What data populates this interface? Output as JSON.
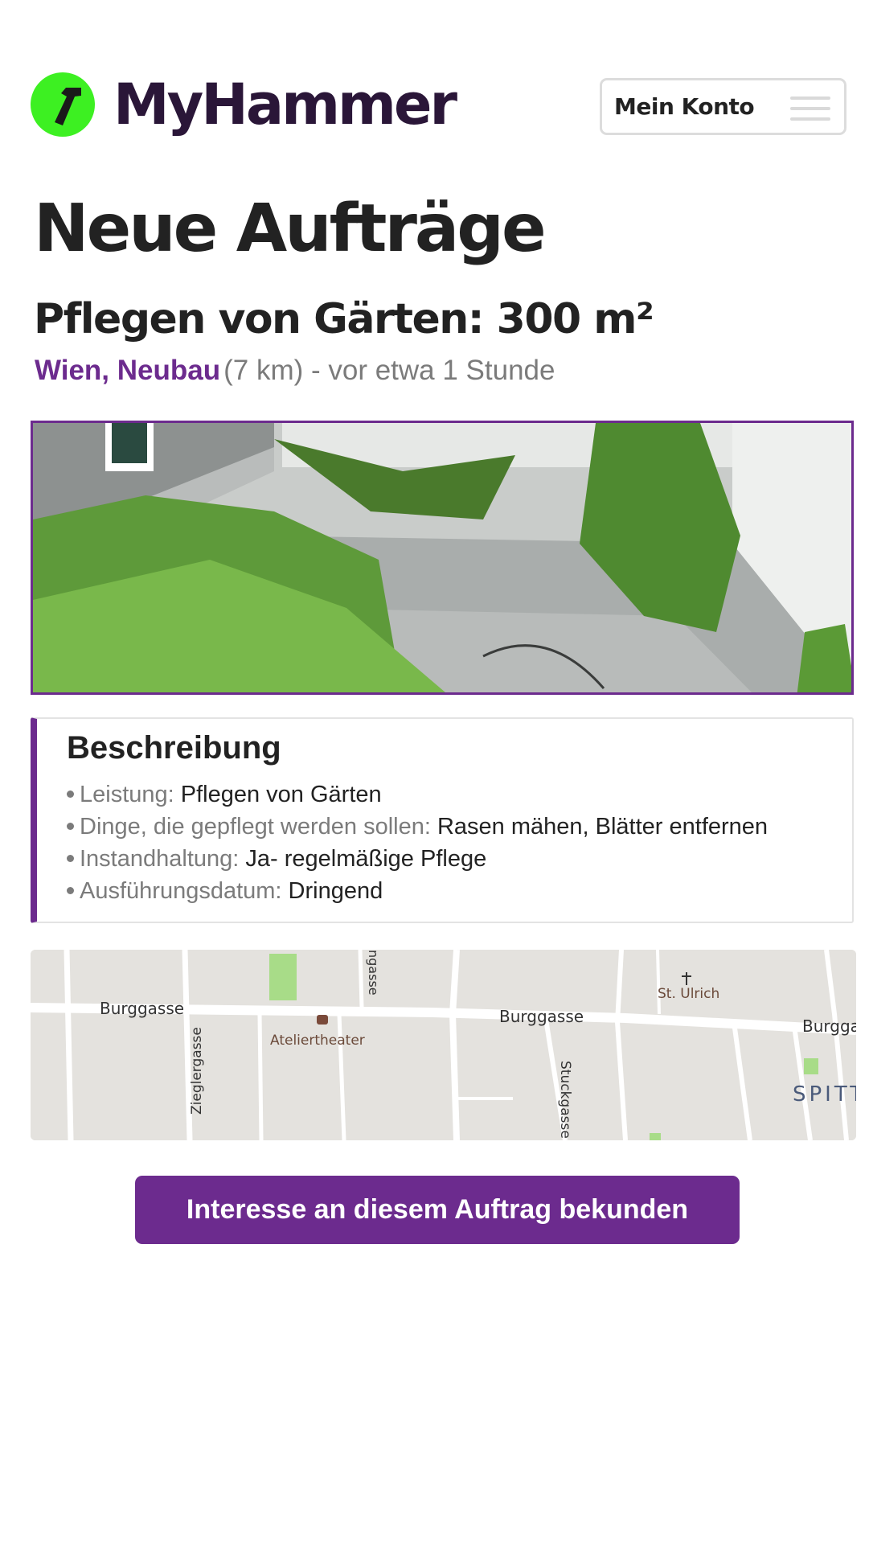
{
  "brand": {
    "name": "MyHammer",
    "icon": "hammer-icon",
    "accent": "#3df022",
    "text_color": "#2a1638"
  },
  "header": {
    "account_label": "Mein Konto",
    "menu_icon": "hamburger-menu-icon"
  },
  "page": {
    "title": "Neue Aufträge"
  },
  "job": {
    "title": "Pflegen von Gärten: 300 m²",
    "location": "Wien, Neubau",
    "distance_time": "(7 km) - vor etwa 1 Stunde",
    "accent": "#6c2b8e"
  },
  "description": {
    "title": "Beschreibung",
    "items": [
      {
        "label": "Leistung:",
        "value": "Pflegen von Gärten"
      },
      {
        "label": "Dinge, die gepflegt werden sollen:",
        "value": "Rasen mähen, Blätter entfernen"
      },
      {
        "label": "Instandhaltung:",
        "value": "Ja- regelmäßige Pflege"
      },
      {
        "label": "Ausführungsdatum:",
        "value": "Dringend"
      }
    ]
  },
  "map": {
    "streets": [
      "Burggasse",
      "Burggasse",
      "Burgga",
      "Zieglergasse",
      "Stuckgasse",
      "ngasse"
    ],
    "places": [
      "Ateliertheater",
      "St. Ulrich"
    ],
    "district": "SPITT"
  },
  "cta": {
    "label": "Interesse an diesem Auftrag bekunden"
  }
}
